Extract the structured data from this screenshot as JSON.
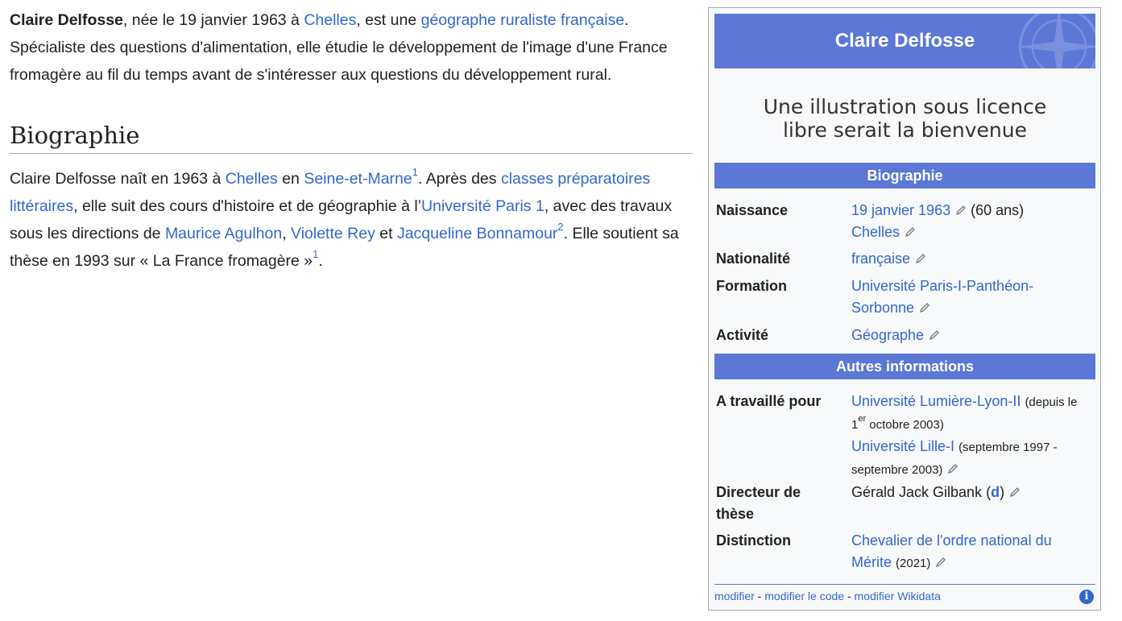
{
  "intro": {
    "name": "Claire Delfosse",
    "t1": ", née le 19 janvier 1963 à ",
    "link_chelles": "Chelles",
    "t2": ", est une ",
    "link_geo": "géographe ruraliste française",
    "t3": ". Spécialiste des questions d'alimentation, elle étudie le développement de l'image d'une France fromagère au fil du temps avant de s'intéresser aux questions du développement rural."
  },
  "biography": {
    "heading": "Biographie",
    "t1": "Claire Delfosse naît en 1963 à ",
    "link_chelles": "Chelles",
    "t2": " en ",
    "link_seine": "Seine-et-Marne",
    "ref1": "1",
    "t3": ". Après des ",
    "link_classes": "classes préparatoires littéraires",
    "t4": ", elle suit des cours d'histoire et de géographie à l’",
    "link_univ": "Université Paris 1",
    "t5": ", avec des travaux sous les directions de ",
    "link_agulhon": "Maurice Agulhon",
    "t6": ", ",
    "link_rey": "Violette Rey",
    "t7": " et ",
    "link_bonnamour": "Jacqueline Bonnamour",
    "ref2": "2",
    "t8": ". Elle soutient sa thèse en 1993 sur « La France fromagère »",
    "ref3": "1",
    "t9": "."
  },
  "infobox": {
    "title": "Claire Delfosse",
    "no_image_line1": "Une illustration sous licence",
    "no_image_line2": "libre serait la bienvenue",
    "section_bio": "Biographie",
    "section_other": "Autres informations",
    "naissance_label": "Naissance",
    "naissance_date": "19 janvier 1963",
    "naissance_age": "(60 ans)",
    "naissance_place": "Chelles",
    "nationalite_label": "Nationalité",
    "nationalite_value": "française",
    "formation_label": "Formation",
    "formation_value": "Université Paris-I-Panthéon-Sorbonne",
    "activite_label": "Activité",
    "activite_value": "Géographe",
    "travaille_label": "A travaillé pour",
    "employer1": "Université Lumière-Lyon-II",
    "employer1_note_a": "(depuis le 1",
    "employer1_note_sup": "er",
    "employer1_note_b": " octobre 2003)",
    "employer2": "Université Lille-I",
    "employer2_note": "(septembre 1997 - septembre 2003)",
    "directeur_label": "Directeur de thèse",
    "directeur_value": "Gérald Jack Gilbank",
    "directeur_d": "d",
    "distinction_label": "Distinction",
    "distinction_value": "Chevalier de l'ordre national du Mérite",
    "distinction_year": "(2021)",
    "footer_modifier": "modifier",
    "footer_code": "modifier le code",
    "footer_wikidata": "modifier Wikidata",
    "footer_sep": " - "
  },
  "colors": {
    "link": "#3366cc",
    "infobox_header": "#5b78d6",
    "text": "#202122"
  },
  "icons": [
    "pencil-icon",
    "info-icon",
    "compass-decoration"
  ]
}
